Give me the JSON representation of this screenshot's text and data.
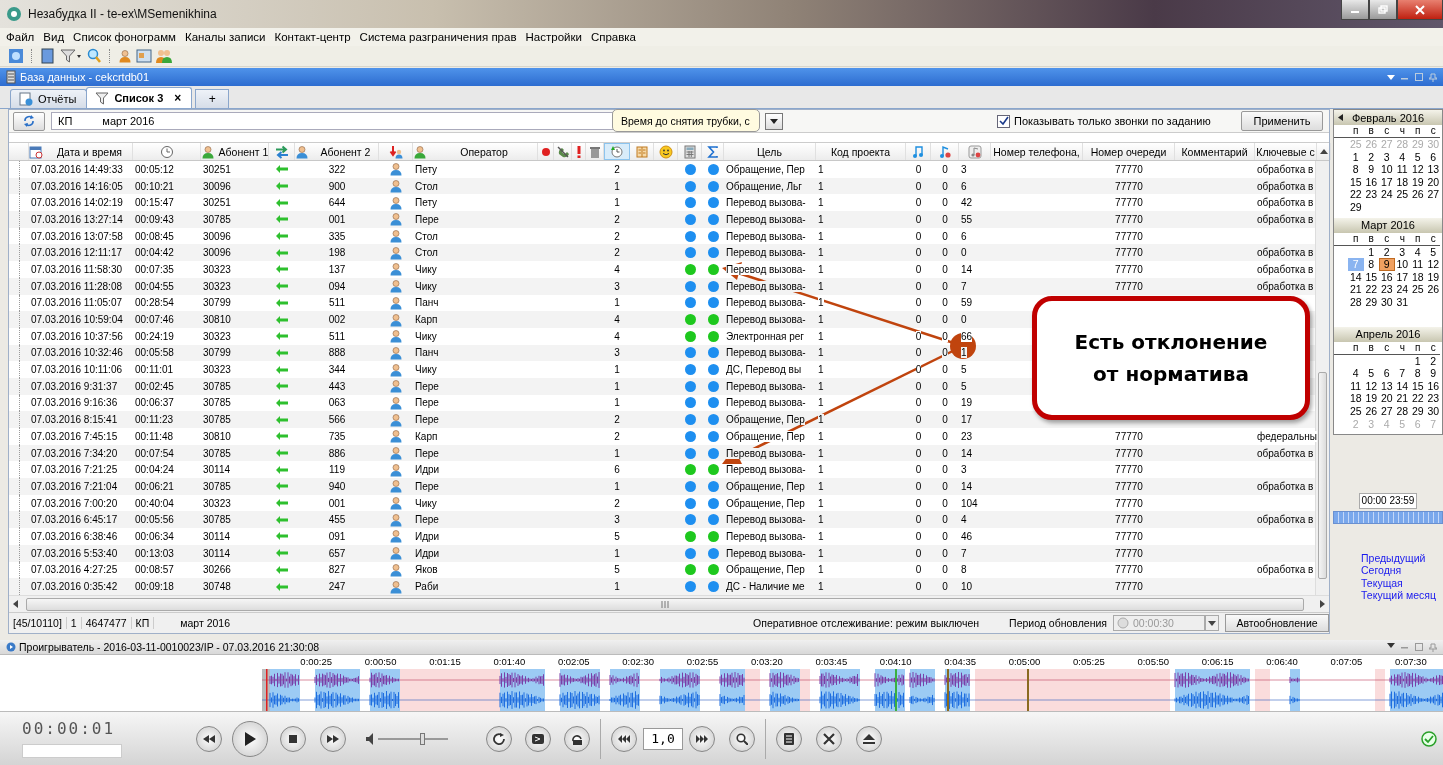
{
  "window": {
    "title": "Незабудка II - te-ex\\MSemenikhina"
  },
  "menu": [
    "Файл",
    "Вид",
    "Список фонограмм",
    "Каналы записи",
    "Контакт-центр",
    "Система разграничения прав",
    "Настройки",
    "Справка"
  ],
  "database_bar": {
    "title": "База данных - cekcrtdb01"
  },
  "tabs": [
    {
      "label": "Отчёты",
      "selected": false
    },
    {
      "label": "Список 3",
      "selected": true,
      "close": "×"
    }
  ],
  "new_tab": "+",
  "filter": {
    "project": "КП",
    "period": "март 2016",
    "only_assigned": {
      "label": "Показывать только звонки по заданию",
      "checked": true
    },
    "apply": "Применить"
  },
  "tooltip": "Время до снятия трубки, с",
  "table": {
    "columns": [
      "Дата и время",
      "Абонент 1",
      "Абонент 2",
      "Оператор",
      "Цель",
      "Код проекта",
      "Номер телефона,",
      "Номер очереди",
      "Комментарий",
      "Ключевые с"
    ],
    "rows": [
      {
        "datetime": "07.03.2016 14:49:33",
        "duration": "00:05:12",
        "subscriber_1": "30251",
        "subscriber_2": "322",
        "operator": "Пету",
        "pickup_time": "2",
        "indicators": [
          {
            "color": "#1e8ff0"
          },
          {
            "color": "#1e8ff0"
          }
        ],
        "goal": "Обращение, Пер",
        "project_code": "1",
        "column_19": "0",
        "column_20": "0",
        "column_21": "3",
        "queue": "77770",
        "keywords": "обработка в"
      },
      {
        "datetime": "07.03.2016 14:16:05",
        "duration": "00:10:21",
        "subscriber_1": "30096",
        "subscriber_2": "900",
        "operator": "Стол",
        "pickup_time": "1",
        "indicators": [
          {
            "color": "#1e8ff0"
          },
          {
            "color": "#1e8ff0"
          }
        ],
        "goal": "Обращение, Льг",
        "project_code": "1",
        "column_19": "0",
        "column_20": "0",
        "column_21": "6",
        "queue": "77770",
        "keywords": "обработка в"
      },
      {
        "datetime": "07.03.2016 14:02:19",
        "duration": "00:15:47",
        "subscriber_1": "30251",
        "subscriber_2": "644",
        "operator": "Пету",
        "pickup_time": "1",
        "indicators": [
          {
            "color": "#1e8ff0"
          },
          {
            "color": "#1e8ff0"
          }
        ],
        "goal": "Перевод вызова-",
        "project_code": "1",
        "column_19": "0",
        "column_20": "0",
        "column_21": "42",
        "queue": "77770",
        "keywords": "обработка в"
      },
      {
        "datetime": "07.03.2016 13:27:14",
        "duration": "00:09:43",
        "subscriber_1": "30785",
        "subscriber_2": "001",
        "operator": "Пере",
        "pickup_time": "2",
        "indicators": [
          {
            "color": "#1e8ff0"
          },
          {
            "color": "#1e8ff0"
          }
        ],
        "goal": "Перевод вызова-",
        "project_code": "1",
        "column_19": "0",
        "column_20": "0",
        "column_21": "55",
        "queue": "77770",
        "keywords": "обработка в"
      },
      {
        "datetime": "07.03.2016 13:07:58",
        "duration": "00:08:45",
        "subscriber_1": "30096",
        "subscriber_2": "335",
        "operator": "Стол",
        "pickup_time": "2",
        "indicators": [
          {
            "color": "#1e8ff0"
          },
          {
            "color": "#1e8ff0"
          }
        ],
        "goal": "Перевод вызова-",
        "project_code": "1",
        "column_19": "0",
        "column_20": "0",
        "column_21": "6",
        "queue": "77770"
      },
      {
        "datetime": "07.03.2016 12:11:17",
        "duration": "00:04:42",
        "subscriber_1": "30096",
        "subscriber_2": "198",
        "operator": "Стол",
        "pickup_time": "2",
        "indicators": [
          {
            "color": "#1e8ff0"
          },
          {
            "color": "#1e8ff0"
          }
        ],
        "goal": "Перевод вызова-",
        "project_code": "1",
        "column_19": "0",
        "column_20": "0",
        "column_21": "0",
        "queue": "77770",
        "keywords": "обработка в"
      },
      {
        "datetime": "07.03.2016 11:58:30",
        "duration": "00:07:35",
        "subscriber_1": "30323",
        "subscriber_2": "137",
        "operator": "Чику",
        "pickup_time": "4",
        "indicators": [
          {
            "color": "#1ec81e"
          },
          {
            "color": "#1ec81e"
          }
        ],
        "goal": "Перевод вызова-",
        "project_code": "1",
        "column_19": "0",
        "column_20": "0",
        "column_21": "14",
        "queue": "77770",
        "keywords": "обработка в"
      },
      {
        "datetime": "07.03.2016 11:28:08",
        "duration": "00:04:55",
        "subscriber_1": "30323",
        "subscriber_2": "094",
        "operator": "Чику",
        "pickup_time": "3",
        "indicators": [
          {
            "color": "#1e8ff0"
          },
          {
            "color": "#1e8ff0"
          }
        ],
        "goal": "Перевод вызова-",
        "project_code": "1",
        "column_19": "0",
        "column_20": "0",
        "column_21": "7",
        "queue": "77770",
        "keywords": "обработка в"
      },
      {
        "datetime": "07.03.2016 11:05:07",
        "duration": "00:28:54",
        "subscriber_1": "30799",
        "subscriber_2": "511",
        "operator": "Панч",
        "pickup_time": "1",
        "indicators": [
          {
            "color": "#1e8ff0"
          },
          {
            "color": "#1e8ff0"
          }
        ],
        "goal": "Перевод вызова-",
        "project_code": "1",
        "column_19": "0",
        "column_20": "0",
        "column_21": "59"
      },
      {
        "datetime": "07.03.2016 10:59:04",
        "duration": "00:07:46",
        "subscriber_1": "30810",
        "subscriber_2": "002",
        "operator": "Карп",
        "pickup_time": "4",
        "indicators": [
          {
            "color": "#1ec81e"
          },
          {
            "color": "#1ec81e"
          }
        ],
        "goal": "Перевод вызова-",
        "project_code": "1",
        "column_19": "0",
        "column_20": "0",
        "column_21": "0"
      },
      {
        "datetime": "07.03.2016 10:37:56",
        "duration": "00:24:19",
        "subscriber_1": "30323",
        "subscriber_2": "511",
        "operator": "Чику",
        "pickup_time": "4",
        "indicators": [
          {
            "color": "#1ec81e"
          },
          {
            "color": "#1ec81e"
          }
        ],
        "goal": "Электронная рег",
        "project_code": "1",
        "column_19": "0",
        "column_20": "0",
        "column_21": "66"
      },
      {
        "datetime": "07.03.2016 10:32:46",
        "duration": "00:05:58",
        "subscriber_1": "30799",
        "subscriber_2": "888",
        "operator": "Панч",
        "pickup_time": "3",
        "indicators": [
          {
            "color": "#1e8ff0"
          },
          {
            "color": "#1e8ff0"
          }
        ],
        "goal": "Перевод вызова-",
        "project_code": "1",
        "column_19": "0",
        "column_20": "0",
        "column_21": "1"
      },
      {
        "datetime": "07.03.2016 10:11:06",
        "duration": "00:11:01",
        "subscriber_1": "30323",
        "subscriber_2": "344",
        "operator": "Чику",
        "pickup_time": "1",
        "indicators": [
          {
            "color": "#1e8ff0"
          },
          {
            "color": "#1e8ff0"
          }
        ],
        "goal": "ДС, Перевод вы",
        "project_code": "1",
        "column_19": "0",
        "column_20": "0",
        "column_21": "5"
      },
      {
        "datetime": "07.03.2016 9:31:37",
        "duration": "00:02:45",
        "subscriber_1": "30785",
        "subscriber_2": "443",
        "operator": "Пере",
        "pickup_time": "1",
        "indicators": [
          {
            "color": "#1e8ff0"
          },
          {
            "color": "#1e8ff0"
          }
        ],
        "goal": "Перевод вызова-",
        "project_code": "1",
        "column_19": "0",
        "column_20": "0",
        "column_21": "5"
      },
      {
        "datetime": "07.03.2016 9:16:36",
        "duration": "00:06:37",
        "subscriber_1": "30785",
        "subscriber_2": "063",
        "operator": "Пере",
        "pickup_time": "1",
        "indicators": [
          {
            "color": "#1e8ff0"
          },
          {
            "color": "#1e8ff0"
          }
        ],
        "goal": "Перевод вызова-",
        "project_code": "1",
        "column_19": "0",
        "column_20": "0",
        "column_21": "19"
      },
      {
        "datetime": "07.03.2016 8:15:41",
        "duration": "00:11:23",
        "subscriber_1": "30785",
        "subscriber_2": "566",
        "operator": "Пере",
        "pickup_time": "2",
        "indicators": [
          {
            "color": "#1e8ff0"
          },
          {
            "color": "#1e8ff0"
          }
        ],
        "goal": "Обращение, Пер",
        "project_code": "1",
        "column_19": "0",
        "column_20": "0",
        "column_21": "17"
      },
      {
        "datetime": "07.03.2016 7:45:15",
        "duration": "00:11:48",
        "subscriber_1": "30810",
        "subscriber_2": "735",
        "operator": "Карп",
        "pickup_time": "2",
        "indicators": [
          {
            "color": "#1e8ff0"
          },
          {
            "color": "#1e8ff0"
          }
        ],
        "goal": "Обращение, Пер",
        "project_code": "1",
        "column_19": "0",
        "column_20": "0",
        "column_21": "23",
        "queue": "77770",
        "keywords": "федеральны"
      },
      {
        "datetime": "07.03.2016 7:34:20",
        "duration": "00:07:54",
        "subscriber_1": "30785",
        "subscriber_2": "886",
        "operator": "Пере",
        "pickup_time": "1",
        "indicators": [
          {
            "color": "#1e8ff0"
          },
          {
            "color": "#1e8ff0"
          }
        ],
        "goal": "Перевод вызова-",
        "project_code": "1",
        "column_19": "0",
        "column_20": "0",
        "column_21": "14",
        "queue": "77770",
        "keywords": "обработка в"
      },
      {
        "datetime": "07.03.2016 7:21:25",
        "duration": "00:04:24",
        "subscriber_1": "30114",
        "subscriber_2": "119",
        "operator": "Идри",
        "pickup_time": "6",
        "indicators": [
          {
            "color": "#1ec81e"
          },
          {
            "color": "#1ec81e"
          }
        ],
        "goal": "Перевод вызова-",
        "project_code": "1",
        "column_19": "0",
        "column_20": "0",
        "column_21": "3",
        "queue": "77770"
      },
      {
        "datetime": "07.03.2016 7:21:04",
        "duration": "00:06:21",
        "subscriber_1": "30785",
        "subscriber_2": "940",
        "operator": "Пере",
        "pickup_time": "1",
        "indicators": [
          {
            "color": "#1e8ff0"
          },
          {
            "color": "#1e8ff0"
          }
        ],
        "goal": "Обращение, Пер",
        "project_code": "1",
        "column_19": "0",
        "column_20": "0",
        "column_21": "14",
        "queue": "77770",
        "keywords": "обработка в"
      },
      {
        "datetime": "07.03.2016 7:00:20",
        "duration": "00:40:04",
        "subscriber_1": "30323",
        "subscriber_2": "001",
        "operator": "Чику",
        "pickup_time": "2",
        "indicators": [
          {
            "color": "#1e8ff0"
          },
          {
            "color": "#1e8ff0"
          }
        ],
        "goal": "Обращение, Пер",
        "project_code": "1",
        "column_19": "0",
        "column_20": "0",
        "column_21": "104",
        "queue": "77770"
      },
      {
        "datetime": "07.03.2016 6:45:17",
        "duration": "00:05:56",
        "subscriber_1": "30785",
        "subscriber_2": "455",
        "operator": "Пере",
        "pickup_time": "3",
        "indicators": [
          {
            "color": "#1e8ff0"
          },
          {
            "color": "#1e8ff0"
          }
        ],
        "goal": "Перевод вызова-",
        "project_code": "1",
        "column_19": "0",
        "column_20": "0",
        "column_21": "4",
        "queue": "77770",
        "keywords": "обработка в"
      },
      {
        "datetime": "07.03.2016 6:38:46",
        "duration": "00:06:34",
        "subscriber_1": "30114",
        "subscriber_2": "091",
        "operator": "Идри",
        "pickup_time": "5",
        "indicators": [
          {
            "color": "#1ec81e"
          },
          {
            "color": "#1ec81e"
          }
        ],
        "goal": "Перевод вызова-",
        "project_code": "1",
        "column_19": "0",
        "column_20": "0",
        "column_21": "46",
        "queue": "77770"
      },
      {
        "datetime": "07.03.2016 5:53:40",
        "duration": "00:13:03",
        "subscriber_1": "30114",
        "subscriber_2": "657",
        "operator": "Идри",
        "pickup_time": "1",
        "indicators": [
          {
            "color": "#1e8ff0"
          },
          {
            "color": "#1e8ff0"
          }
        ],
        "goal": "Перевод вызова-",
        "project_code": "1",
        "column_19": "0",
        "column_20": "0",
        "column_21": "7",
        "queue": "77770"
      },
      {
        "datetime": "07.03.2016 4:27:25",
        "duration": "00:08:57",
        "subscriber_1": "30266",
        "subscriber_2": "827",
        "operator": "Яков",
        "pickup_time": "5",
        "indicators": [
          {
            "color": "#1ec81e"
          },
          {
            "color": "#1ec81e"
          }
        ],
        "goal": "Обращение, Пер",
        "project_code": "1",
        "column_19": "0",
        "column_20": "0",
        "column_21": "8",
        "queue": "77770",
        "keywords": "обработка в"
      },
      {
        "datetime": "07.03.2016 0:35:42",
        "duration": "00:09:18",
        "subscriber_1": "30748",
        "subscriber_2": "247",
        "operator": "Раби",
        "pickup_time": "1",
        "indicators": [
          {
            "color": "#1e8ff0"
          },
          {
            "color": "#1e8ff0"
          }
        ],
        "goal": "ДС - Наличие ме",
        "project_code": "1",
        "column_19": "0",
        "column_20": "0",
        "column_21": "10",
        "queue": "77770"
      }
    ]
  },
  "status_bar": {
    "counts": [
      "[45/10110]",
      "1",
      "4647477"
    ],
    "project": "КП",
    "period": "март 2016",
    "tracking": "Оперативное отслеживание: режим выключен",
    "refresh_label": "Период обновления",
    "refresh_period": {
      "value": "00:00:30",
      "disabled": true
    },
    "autorefresh": "Автообновление"
  },
  "calendar": {
    "months": [
      {
        "title": "Февраль 2016",
        "weekdays": [
          "п",
          "в",
          "с",
          "ч",
          "п",
          "с"
        ],
        "weeks": [
          [
            {
              "d": "25",
              "kind": "other"
            },
            {
              "d": "26",
              "kind": "other"
            },
            {
              "d": "27",
              "kind": "other"
            },
            {
              "d": "28",
              "kind": "other"
            },
            {
              "d": "29",
              "kind": "other"
            },
            {
              "d": "30",
              "kind": "other"
            }
          ],
          [
            {
              "d": "1",
              "kind": "day"
            },
            {
              "d": "2",
              "kind": "day"
            },
            {
              "d": "3",
              "kind": "day"
            },
            {
              "d": "4",
              "kind": "day"
            },
            {
              "d": "5",
              "kind": "day"
            },
            {
              "d": "6",
              "kind": "day"
            }
          ],
          [
            {
              "d": "8",
              "kind": "day"
            },
            {
              "d": "9",
              "kind": "day"
            },
            {
              "d": "10",
              "kind": "day"
            },
            {
              "d": "11",
              "kind": "day"
            },
            {
              "d": "12",
              "kind": "day"
            },
            {
              "d": "13",
              "kind": "day"
            }
          ],
          [
            {
              "d": "15",
              "kind": "day"
            },
            {
              "d": "16",
              "kind": "day"
            },
            {
              "d": "17",
              "kind": "day"
            },
            {
              "d": "18",
              "kind": "day"
            },
            {
              "d": "19",
              "kind": "day"
            },
            {
              "d": "20",
              "kind": "day"
            }
          ],
          [
            {
              "d": "22",
              "kind": "day"
            },
            {
              "d": "23",
              "kind": "day"
            },
            {
              "d": "24",
              "kind": "day"
            },
            {
              "d": "25",
              "kind": "day"
            },
            {
              "d": "26",
              "kind": "day"
            },
            {
              "d": "27",
              "kind": "day"
            }
          ],
          [
            {
              "d": "29",
              "kind": "day"
            }
          ]
        ]
      },
      {
        "title": "Март 2016",
        "weekdays": [
          "п",
          "в",
          "с",
          "ч",
          "п",
          "с"
        ],
        "weeks": [
          [
            {
              "d": "1",
              "kind": "day"
            },
            {
              "d": "2",
              "kind": "day"
            },
            {
              "d": "3",
              "kind": "day"
            },
            {
              "d": "4",
              "kind": "day"
            },
            {
              "d": "5",
              "kind": "day"
            }
          ],
          [
            {
              "d": "7",
              "kind": "today"
            },
            {
              "d": "8",
              "kind": "day"
            },
            {
              "d": "9",
              "kind": "selected"
            },
            {
              "d": "10",
              "kind": "day"
            },
            {
              "d": "11",
              "kind": "day"
            },
            {
              "d": "12",
              "kind": "day"
            }
          ],
          [
            {
              "d": "14",
              "kind": "day"
            },
            {
              "d": "15",
              "kind": "day"
            },
            {
              "d": "16",
              "kind": "day"
            },
            {
              "d": "17",
              "kind": "day"
            },
            {
              "d": "18",
              "kind": "day"
            },
            {
              "d": "19",
              "kind": "day"
            }
          ],
          [
            {
              "d": "21",
              "kind": "day"
            },
            {
              "d": "22",
              "kind": "day"
            },
            {
              "d": "23",
              "kind": "day"
            },
            {
              "d": "24",
              "kind": "day"
            },
            {
              "d": "25",
              "kind": "day"
            },
            {
              "d": "26",
              "kind": "day"
            }
          ],
          [
            {
              "d": "28",
              "kind": "day"
            },
            {
              "d": "29",
              "kind": "day"
            },
            {
              "d": "30",
              "kind": "day"
            },
            {
              "d": "31",
              "kind": "day"
            }
          ]
        ]
      },
      {
        "title": "Апрель 2016",
        "weekdays": [
          "п",
          "в",
          "с",
          "ч",
          "п",
          "с"
        ],
        "weeks": [
          [
            {
              "d": "1",
              "kind": "day"
            },
            {
              "d": "2",
              "kind": "day"
            }
          ],
          [
            {
              "d": "4",
              "kind": "day"
            },
            {
              "d": "5",
              "kind": "day"
            },
            {
              "d": "6",
              "kind": "day"
            },
            {
              "d": "7",
              "kind": "day"
            },
            {
              "d": "8",
              "kind": "day"
            },
            {
              "d": "9",
              "kind": "day"
            }
          ],
          [
            {
              "d": "11",
              "kind": "day"
            },
            {
              "d": "12",
              "kind": "day"
            },
            {
              "d": "13",
              "kind": "day"
            },
            {
              "d": "14",
              "kind": "day"
            },
            {
              "d": "15",
              "kind": "day"
            },
            {
              "d": "16",
              "kind": "day"
            }
          ],
          [
            {
              "d": "18",
              "kind": "day"
            },
            {
              "d": "19",
              "kind": "day"
            },
            {
              "d": "20",
              "kind": "day"
            },
            {
              "d": "21",
              "kind": "day"
            },
            {
              "d": "22",
              "kind": "day"
            },
            {
              "d": "23",
              "kind": "day"
            }
          ],
          [
            {
              "d": "25",
              "kind": "day"
            },
            {
              "d": "26",
              "kind": "day"
            },
            {
              "d": "27",
              "kind": "day"
            },
            {
              "d": "28",
              "kind": "day"
            },
            {
              "d": "29",
              "kind": "day"
            },
            {
              "d": "30",
              "kind": "day"
            }
          ],
          [
            {
              "d": "2",
              "kind": "other"
            },
            {
              "d": "3",
              "kind": "other"
            },
            {
              "d": "4",
              "kind": "other"
            },
            {
              "d": "5",
              "kind": "other"
            },
            {
              "d": "6",
              "kind": "other"
            },
            {
              "d": "7",
              "kind": "other"
            }
          ]
        ]
      }
    ],
    "time_range": "00:00 23:59",
    "time_slider": {
      "level": 1
    },
    "links": [
      "Предыдущий",
      "Сегодня",
      "Текущая",
      "Текущий месяц"
    ]
  },
  "player": {
    "title": "Проигрыватель - 2016-03-11-0010023/IP - 07.03.2016 21:30:08",
    "ticks": [
      "0:00:25",
      "0:00:50",
      "0:01:15",
      "0:01:40",
      "0:02:05",
      "0:02:30",
      "0:02:55",
      "0:03:20",
      "0:03:45",
      "0:04:10",
      "0:04:35",
      "0:05:00",
      "0:05:25",
      "0:05:50",
      "0:06:15",
      "0:06:40",
      "0:07:05",
      "0:07:30"
    ],
    "position": "00:00:01",
    "volume": {
      "level": 0.65
    },
    "speed": "1,0"
  },
  "annotation": {
    "text": "Есть отклонение от норматива"
  }
}
